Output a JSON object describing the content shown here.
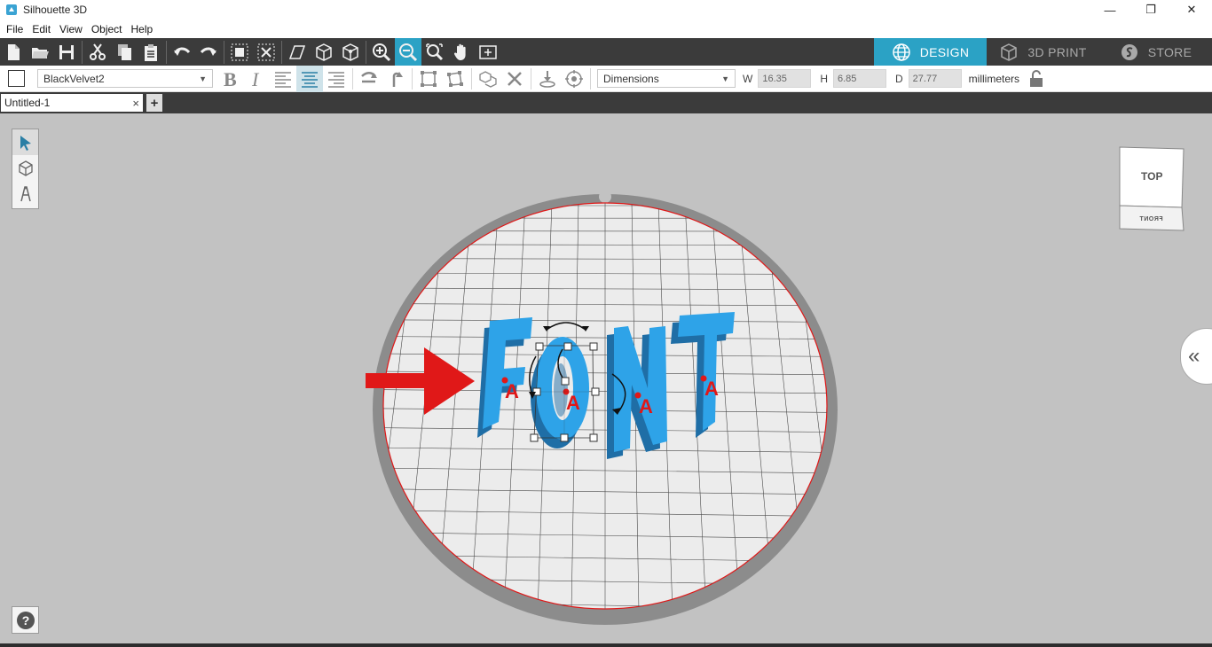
{
  "window": {
    "title": "Silhouette 3D",
    "minimize": "—",
    "restore": "❐",
    "close": "✕"
  },
  "menu": [
    "File",
    "Edit",
    "View",
    "Object",
    "Help"
  ],
  "modes": {
    "design": "DESIGN",
    "print": "3D PRINT",
    "store": "STORE"
  },
  "props": {
    "font": "BlackVelvet2",
    "dim_mode": "Dimensions",
    "w_label": "W",
    "w_value": "16.35",
    "h_label": "H",
    "h_value": "6.85",
    "d_label": "D",
    "d_value": "27.77",
    "units": "millimeters"
  },
  "document": {
    "tab_name": "Untitled-1",
    "close": "×",
    "add": "+"
  },
  "scene": {
    "text": "FONT",
    "anchor_glyph": "A",
    "text_color": "#2ea3e8",
    "arrow_color": "#e01818"
  },
  "view_cube": {
    "top": "TOP",
    "front": "FRONT"
  },
  "help": "?",
  "collapse": "«",
  "colors": {
    "accent": "#2ba2c5",
    "toolbar_bg": "#3b3b3b",
    "canvas_bg": "#c2c2c2"
  }
}
